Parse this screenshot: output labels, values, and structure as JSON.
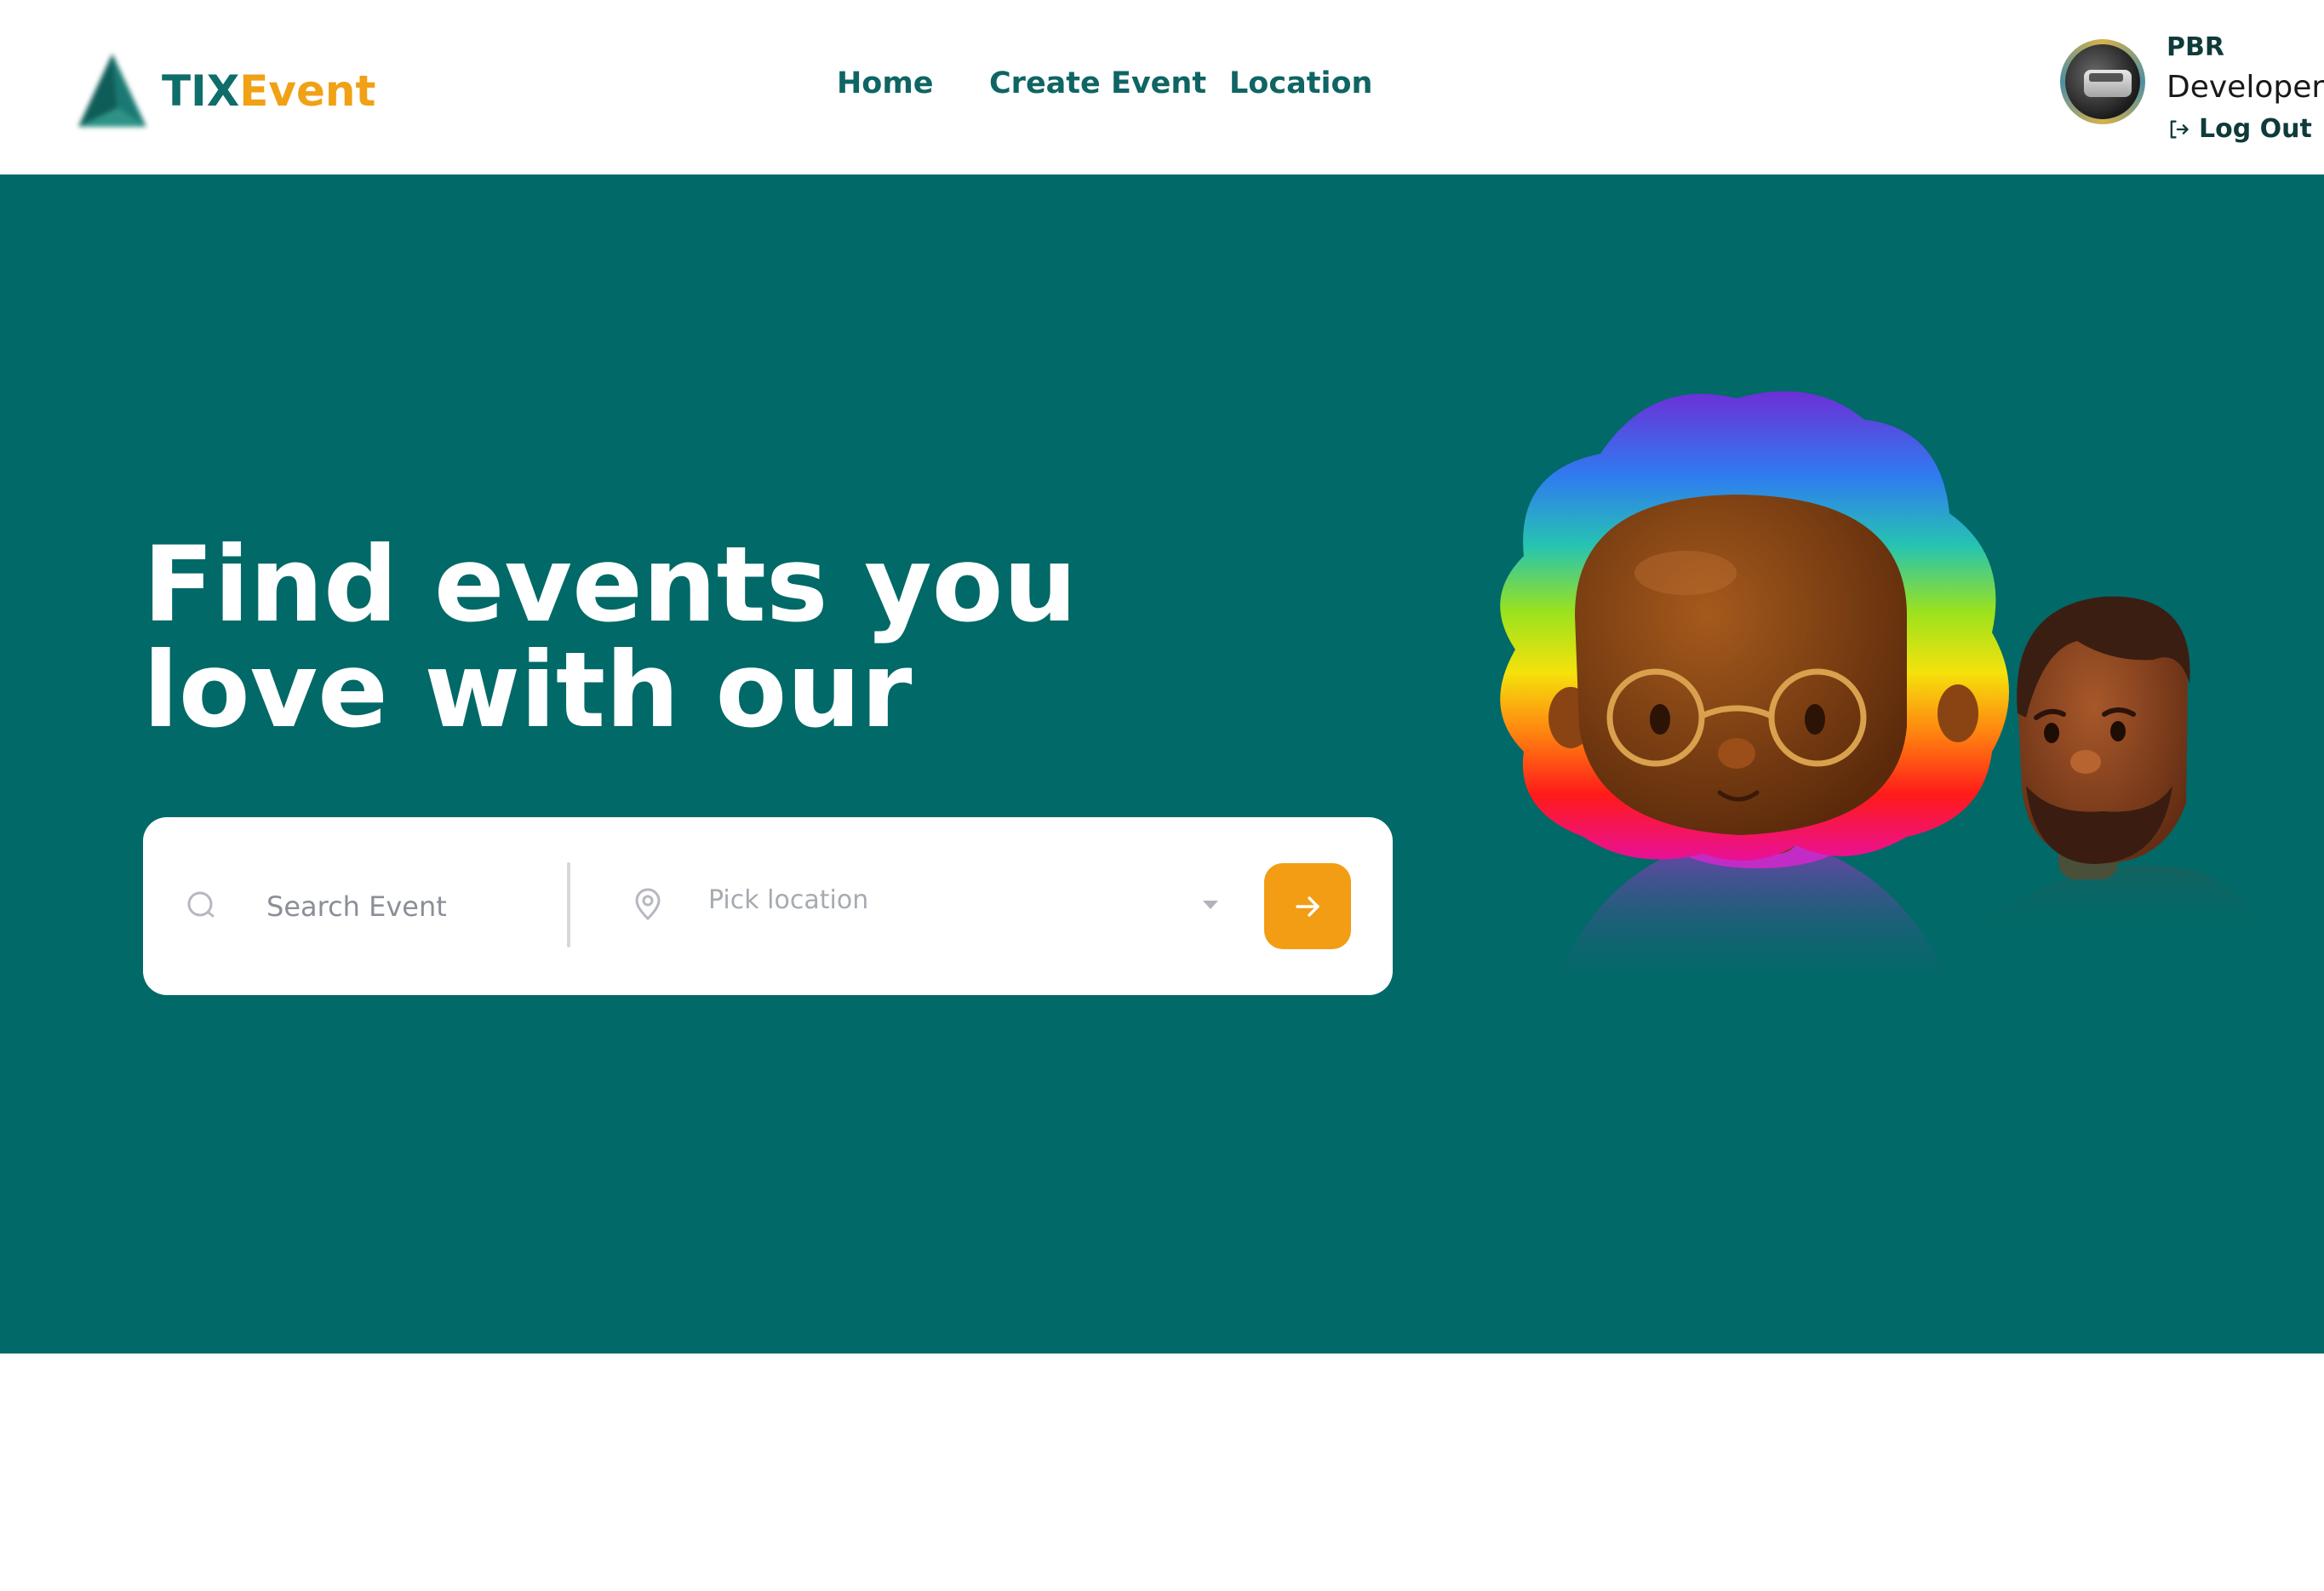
{
  "brand": {
    "part1": "TIX",
    "part2": "Event",
    "primary_color": "#0f6d6a",
    "accent_color": "#f0a116"
  },
  "nav": {
    "items": [
      "Home",
      "Create Event",
      "Location"
    ]
  },
  "profile": {
    "name": "PBR",
    "role": "Developer, ID",
    "logout_label": "Log Out"
  },
  "hero": {
    "background": "#016967",
    "headline_line1": "Find events you",
    "headline_line2": "love with our",
    "search": {
      "placeholder": "Search Event",
      "location_placeholder": "Pick location",
      "submit_icon": "arrow-right-icon",
      "submit_color": "#f29d13"
    },
    "illustration": "two-3d-avatars"
  }
}
